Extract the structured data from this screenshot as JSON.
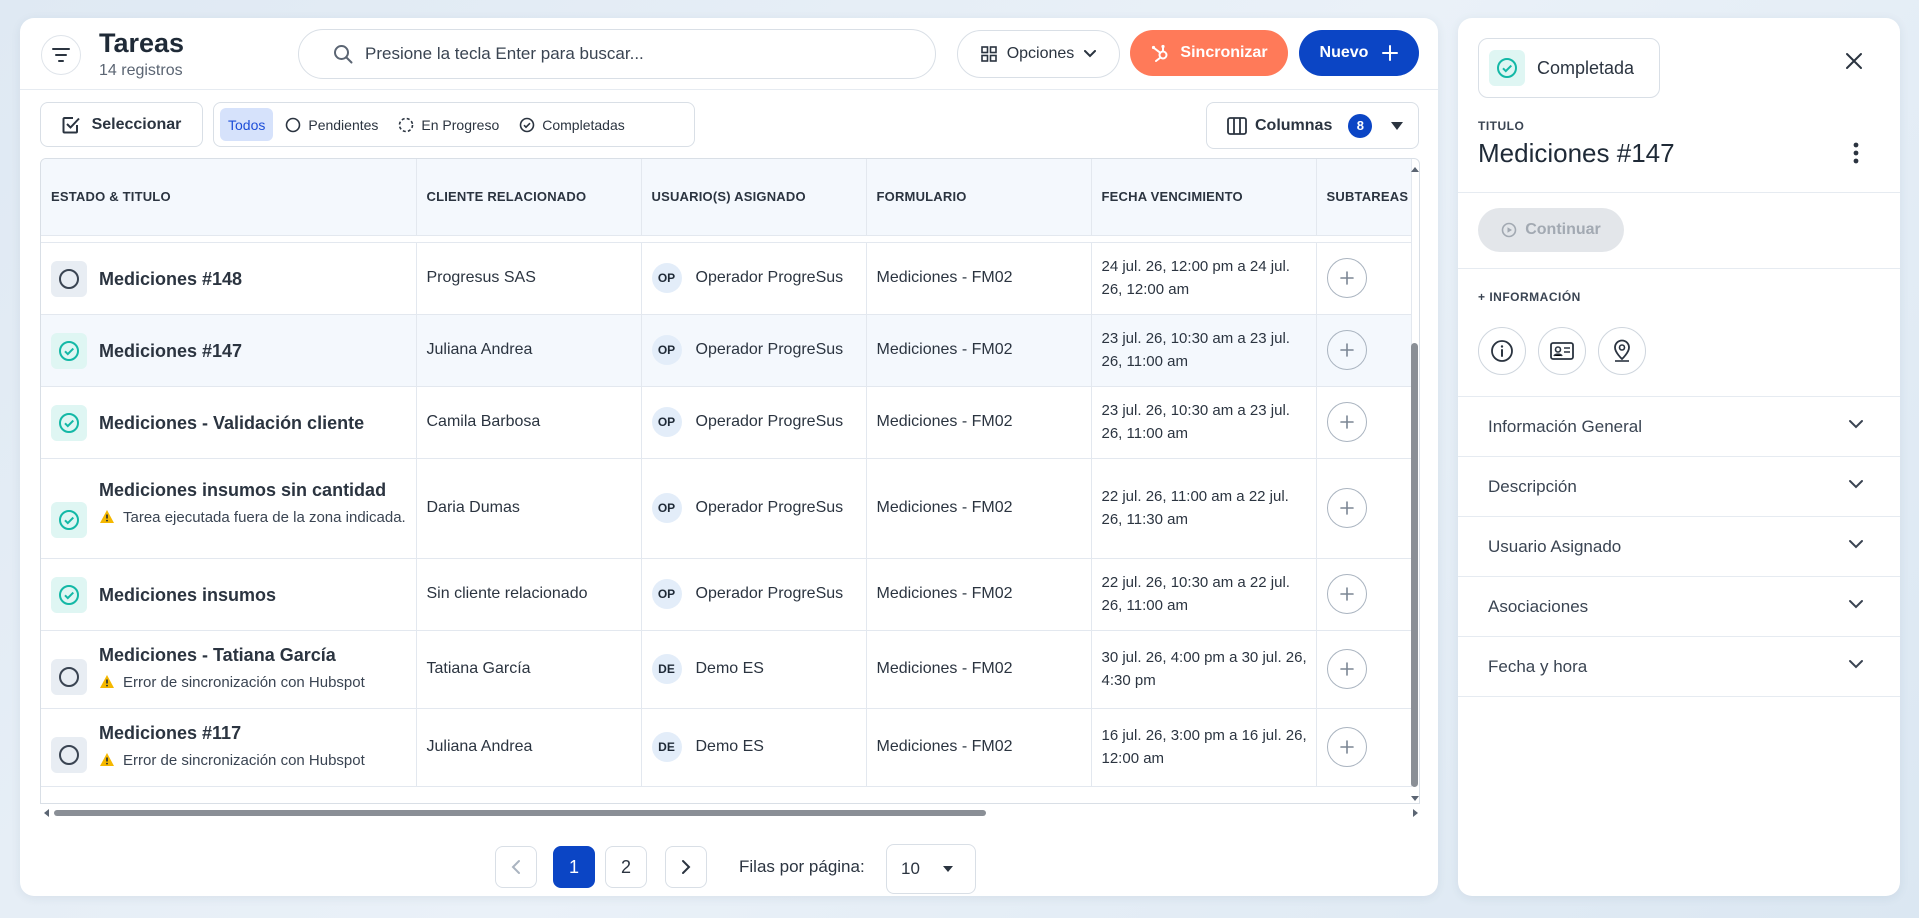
{
  "header": {
    "title": "Tareas",
    "count": "14 registros",
    "search_placeholder": "Presione la tecla Enter para buscar...",
    "options_label": "Opciones",
    "sync_label": "Sincronizar",
    "new_label": "Nuevo"
  },
  "toolbar": {
    "select_label": "Seleccionar",
    "filters": [
      "Todos",
      "Pendientes",
      "En Progreso",
      "Completadas"
    ],
    "columns_label": "Columnas",
    "columns_count": "8"
  },
  "table": {
    "columns": [
      "ESTADO & TITULO",
      "CLIENTE RELACIONADO",
      "USUARIO(S) ASIGNADO",
      "FORMULARIO",
      "FECHA VENCIMIENTO",
      "SUBTAREAS"
    ],
    "rows": [
      {
        "status": "pending",
        "title": "Mediciones #148",
        "warning": "",
        "client": "Progresus SAS",
        "user_initials": "OP",
        "user": "Operador ProgreSus",
        "form": "Mediciones - FM02",
        "due": "24 jul. 26, 12:00 pm a 24 jul. 26, 12:00 am"
      },
      {
        "status": "done",
        "title": "Mediciones #147",
        "warning": "",
        "client": "Juliana Andrea",
        "user_initials": "OP",
        "user": "Operador ProgreSus",
        "form": "Mediciones - FM02",
        "due": "23 jul. 26, 10:30 am a 23 jul. 26, 11:00 am"
      },
      {
        "status": "done",
        "title": "Mediciones - Validación cliente",
        "warning": "",
        "client": "Camila Barbosa",
        "user_initials": "OP",
        "user": "Operador ProgreSus",
        "form": "Mediciones - FM02",
        "due": "23 jul. 26, 10:30 am a 23 jul. 26, 11:00 am"
      },
      {
        "status": "done",
        "title": "Mediciones insumos sin cantidad",
        "warning": "Tarea ejecutada fuera de la zona indicada.",
        "client": "Daria Dumas",
        "user_initials": "OP",
        "user": "Operador ProgreSus",
        "form": "Mediciones - FM02",
        "due": "22 jul. 26, 11:00 am a 22 jul. 26, 11:30 am"
      },
      {
        "status": "done",
        "title": "Mediciones insumos",
        "warning": "",
        "client": "Sin cliente relacionado",
        "user_initials": "OP",
        "user": "Operador ProgreSus",
        "form": "Mediciones - FM02",
        "due": "22 jul. 26, 10:30 am a 22 jul. 26, 11:00 am"
      },
      {
        "status": "pending",
        "title": "Mediciones - Tatiana García",
        "warning": "Error de sincronización con Hubspot",
        "client": "Tatiana García",
        "user_initials": "DE",
        "user": "Demo ES",
        "form": "Mediciones - FM02",
        "due": "30 jul. 26, 4:00 pm a 30 jul. 26, 4:30 pm"
      },
      {
        "status": "pending",
        "title": "Mediciones #117",
        "warning": "Error de sincronización con Hubspot",
        "client": "Juliana Andrea",
        "user_initials": "DE",
        "user": "Demo ES",
        "form": "Mediciones - FM02",
        "due": "16 jul. 26, 3:00 pm a 16 jul. 26, 12:00 am"
      }
    ]
  },
  "pagination": {
    "pages": [
      "1",
      "2"
    ],
    "rows_label": "Filas por página:",
    "rows_value": "10"
  },
  "side": {
    "status": "Completada",
    "title_label": "TITULO",
    "title": "Mediciones #147",
    "continue_label": "Continuar",
    "info_label": "+ INFORMACIÓN",
    "sections": [
      "Información General",
      "Descripción",
      "Usuario Asignado",
      "Asociaciones",
      "Fecha y hora"
    ]
  },
  "colors": {
    "primary": "#0b45c5",
    "sync": "#ff7a59",
    "done": "#14b8a6",
    "warning": "#f5b800"
  }
}
